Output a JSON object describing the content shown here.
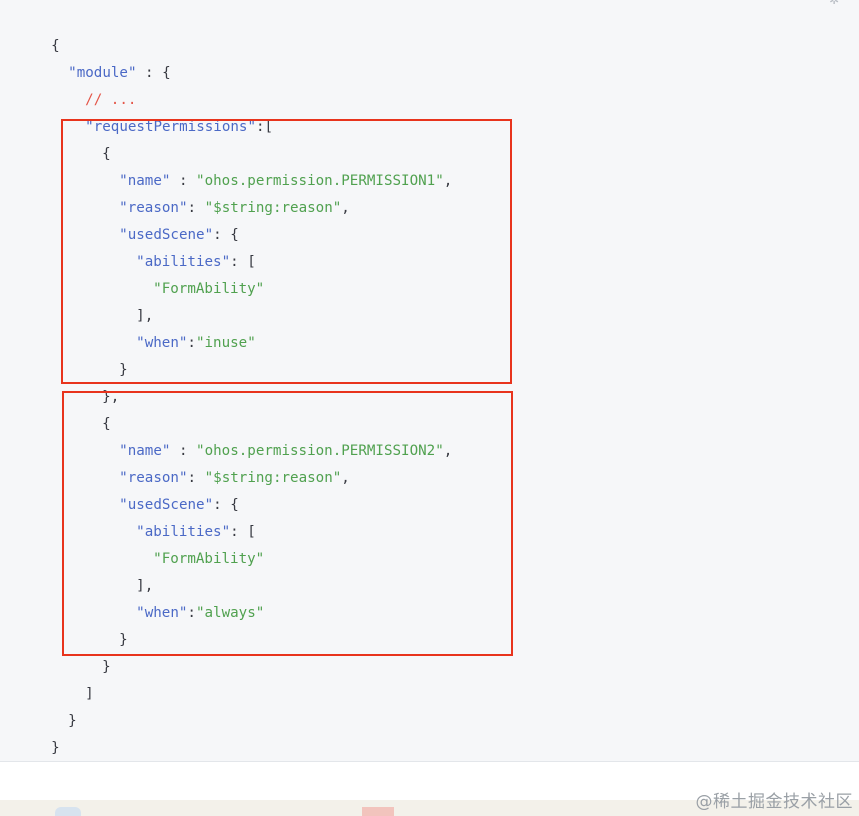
{
  "code": {
    "line1": {
      "punct": "{"
    },
    "line2": {
      "key": "\"module\"",
      "punct": " : {"
    },
    "line3": {
      "comment": "// ..."
    },
    "line4": {
      "key": "\"requestPermissions\"",
      "punct": ":["
    },
    "line5": {
      "punct": "{"
    },
    "line6": {
      "key": "\"name\"",
      "sep": " : ",
      "value": "\"ohos.permission.PERMISSION1\"",
      "tail": ","
    },
    "line7": {
      "key": "\"reason\"",
      "sep": ": ",
      "value": "\"$string:reason\"",
      "tail": ","
    },
    "line8": {
      "key": "\"usedScene\"",
      "punct": ": {"
    },
    "line9": {
      "key": "\"abilities\"",
      "punct": ": ["
    },
    "line10": {
      "value": "\"FormAbility\""
    },
    "line11": {
      "punct": "],"
    },
    "line12": {
      "key": "\"when\"",
      "sep": ":",
      "value": "\"inuse\""
    },
    "line13": {
      "punct": "}"
    },
    "line14": {
      "punct": "},"
    },
    "line15": {
      "punct": "{"
    },
    "line16": {
      "key": "\"name\"",
      "sep": " : ",
      "value": "\"ohos.permission.PERMISSION2\"",
      "tail": ","
    },
    "line17": {
      "key": "\"reason\"",
      "sep": ": ",
      "value": "\"$string:reason\"",
      "tail": ","
    },
    "line18": {
      "key": "\"usedScene\"",
      "punct": ": {"
    },
    "line19": {
      "key": "\"abilities\"",
      "punct": ": ["
    },
    "line20": {
      "value": "\"FormAbility\""
    },
    "line21": {
      "punct": "],"
    },
    "line22": {
      "key": "\"when\"",
      "sep": ":",
      "value": "\"always\""
    },
    "line23": {
      "punct": "}"
    },
    "line24": {
      "punct": "}"
    },
    "line25": {
      "punct": "]"
    },
    "line26": {
      "punct": "}"
    },
    "line27": {
      "punct": "}"
    }
  },
  "watermark": "@稀土掘金技术社区",
  "colors": {
    "key": "#4b69c6",
    "string": "#50a14f",
    "comment": "#e45649",
    "highlight_border": "#e8341d",
    "panel_background": "#f6f7f9"
  },
  "icons": [
    "copy-icon"
  ]
}
